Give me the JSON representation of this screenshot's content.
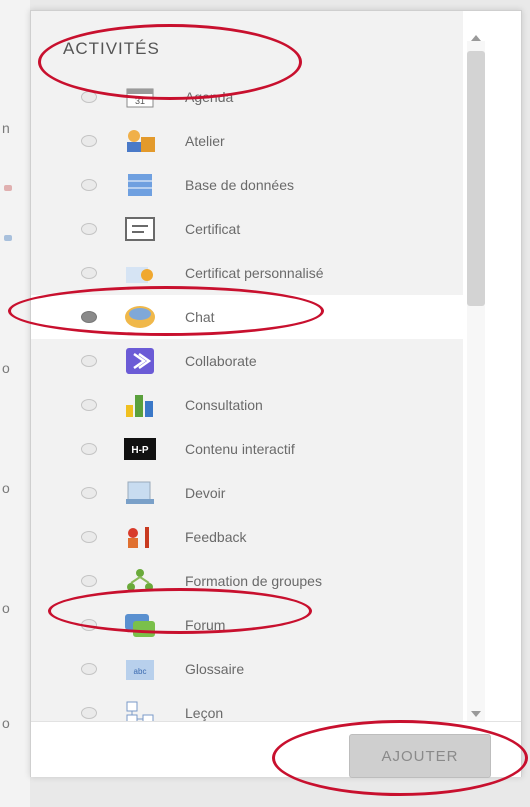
{
  "heading": "ACTIVITÉS",
  "activities": [
    {
      "label": "Agenda",
      "icon": "calendar-icon",
      "selected": false
    },
    {
      "label": "Atelier",
      "icon": "workshop-icon",
      "selected": false
    },
    {
      "label": "Base de données",
      "icon": "database-icon",
      "selected": false
    },
    {
      "label": "Certificat",
      "icon": "certificate-icon",
      "selected": false
    },
    {
      "label": "Certificat personnalisé",
      "icon": "custom-certificate-icon",
      "selected": false
    },
    {
      "label": "Chat",
      "icon": "chat-icon",
      "selected": true
    },
    {
      "label": "Collaborate",
      "icon": "collaborate-icon",
      "selected": false
    },
    {
      "label": "Consultation",
      "icon": "choice-chart-icon",
      "selected": false
    },
    {
      "label": "Contenu interactif",
      "icon": "h5p-icon",
      "selected": false
    },
    {
      "label": "Devoir",
      "icon": "assignment-icon",
      "selected": false
    },
    {
      "label": "Feedback",
      "icon": "feedback-icon",
      "selected": false
    },
    {
      "label": "Formation de groupes",
      "icon": "group-formation-icon",
      "selected": false
    },
    {
      "label": "Forum",
      "icon": "forum-icon",
      "selected": false
    },
    {
      "label": "Glossaire",
      "icon": "glossary-icon",
      "selected": false
    },
    {
      "label": "Leçon",
      "icon": "lesson-icon",
      "selected": false
    }
  ],
  "footer": {
    "add_label": "AJOUTER"
  },
  "colors": {
    "highlight_circle": "#c8102e",
    "selected_row": "#ffffff"
  }
}
